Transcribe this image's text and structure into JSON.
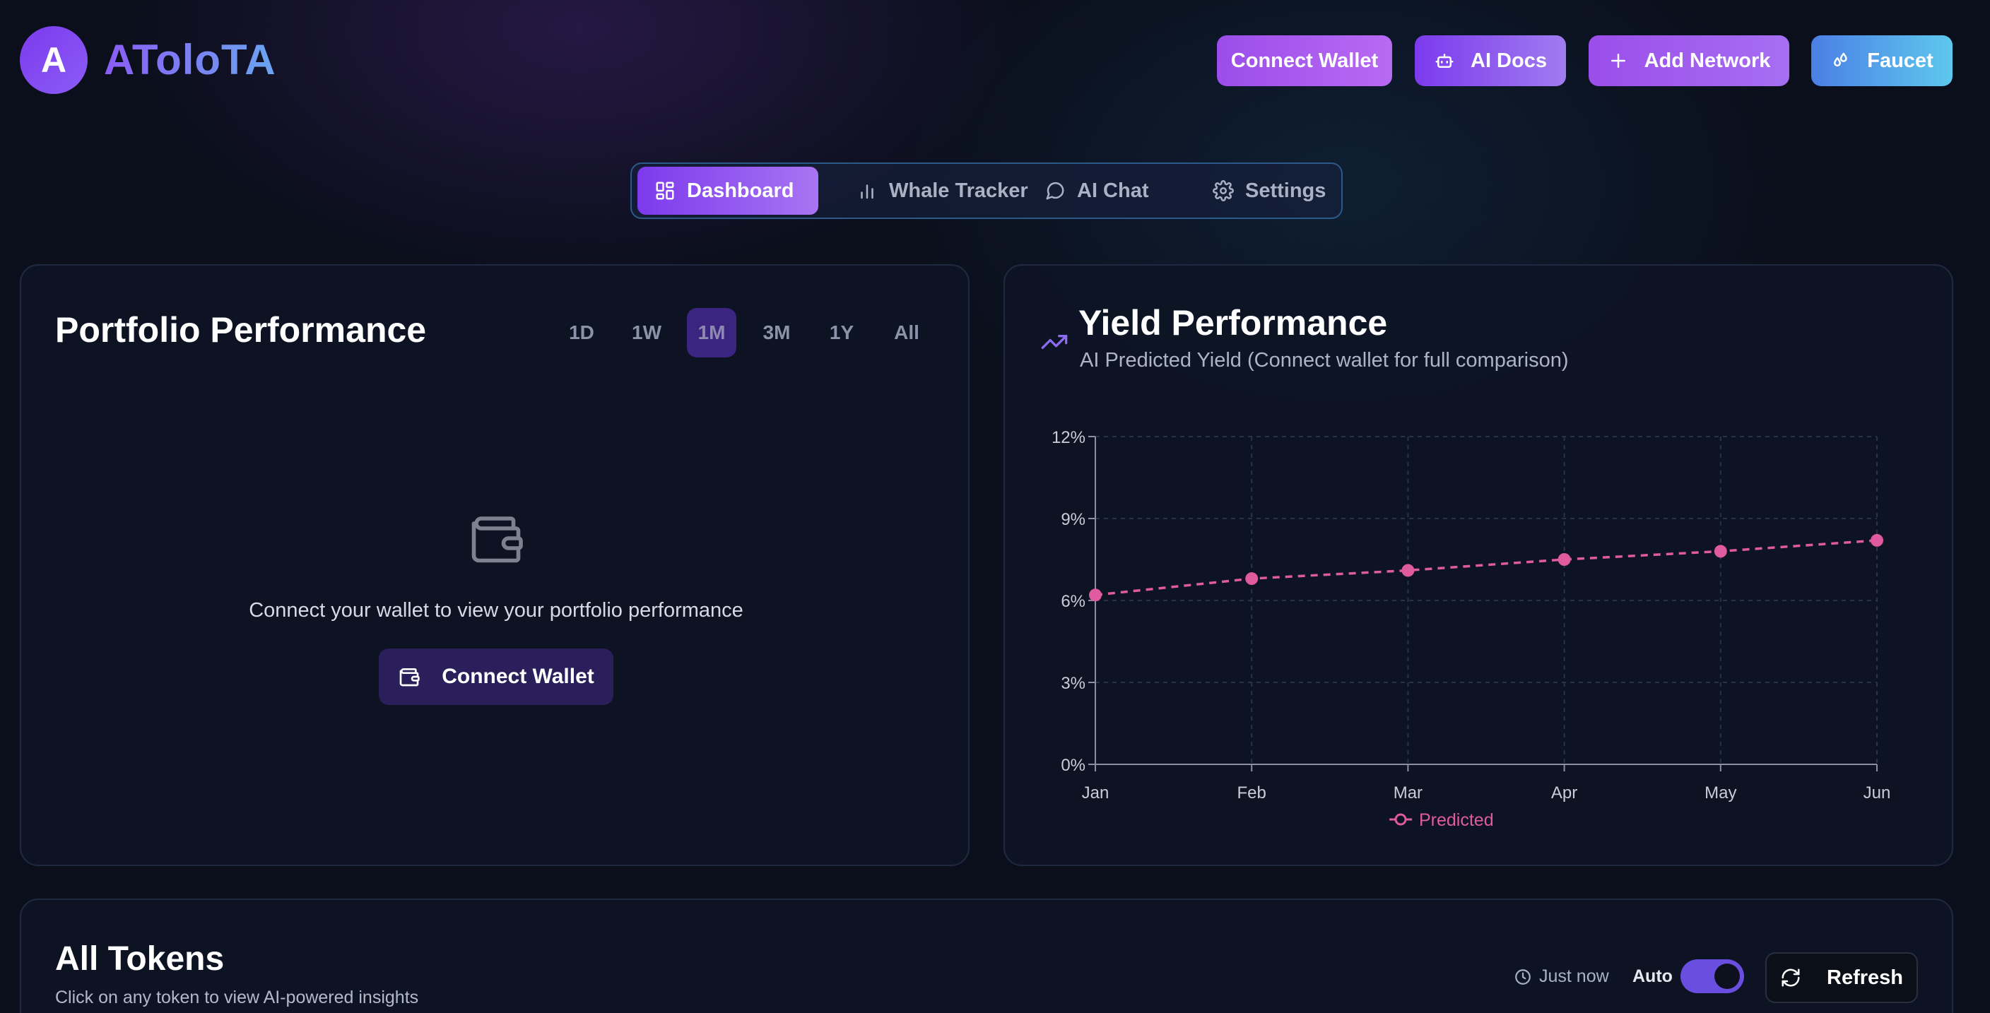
{
  "app": {
    "logo_letter": "A",
    "name": "ATolоTA"
  },
  "header": {
    "connect_wallet": "Connect Wallet",
    "ai_docs": "AI Docs",
    "add_network": "Add Network",
    "faucet": "Faucet"
  },
  "nav": {
    "tabs": [
      {
        "label": "Dashboard",
        "icon": "dashboard-icon",
        "active": true
      },
      {
        "label": "Whale Tracker",
        "icon": "bar-chart-icon",
        "active": false
      },
      {
        "label": "AI Chat",
        "icon": "chat-bubble-icon",
        "active": false
      },
      {
        "label": "Settings",
        "icon": "gear-icon",
        "active": false
      }
    ]
  },
  "portfolio": {
    "title": "Portfolio Performance",
    "ranges": [
      "1D",
      "1W",
      "1M",
      "3M",
      "1Y",
      "All"
    ],
    "selected_range": "1M",
    "empty_message": "Connect your wallet to view your portfolio performance",
    "connect_button": "Connect Wallet"
  },
  "yield": {
    "title": "Yield Performance",
    "subtitle": "AI Predicted Yield (Connect wallet for full comparison)"
  },
  "chart_data": {
    "type": "line",
    "title": "",
    "xlabel": "",
    "ylabel": "",
    "categories": [
      "Jan",
      "Feb",
      "Mar",
      "Apr",
      "May",
      "Jun"
    ],
    "series": [
      {
        "name": "Predicted",
        "values": [
          6.2,
          6.8,
          7.1,
          7.5,
          7.8,
          8.2
        ],
        "color": "#e05aa0",
        "dashed": true
      }
    ],
    "ylim": [
      0,
      12
    ],
    "yticks": [
      "0%",
      "3%",
      "6%",
      "9%",
      "12%"
    ],
    "ytick_values": [
      0,
      3,
      6,
      9,
      12
    ],
    "grid": true,
    "legend": "bottom-center"
  },
  "tokens": {
    "title": "All Tokens",
    "subtitle": "Click on any token to view AI-powered insights",
    "last_updated": "Just now",
    "auto_label": "Auto",
    "auto_enabled": true,
    "refresh": "Refresh"
  },
  "colors": {
    "accent": "#7c3aed",
    "chart_line": "#e05aa0",
    "background": "#0b0f1c"
  }
}
